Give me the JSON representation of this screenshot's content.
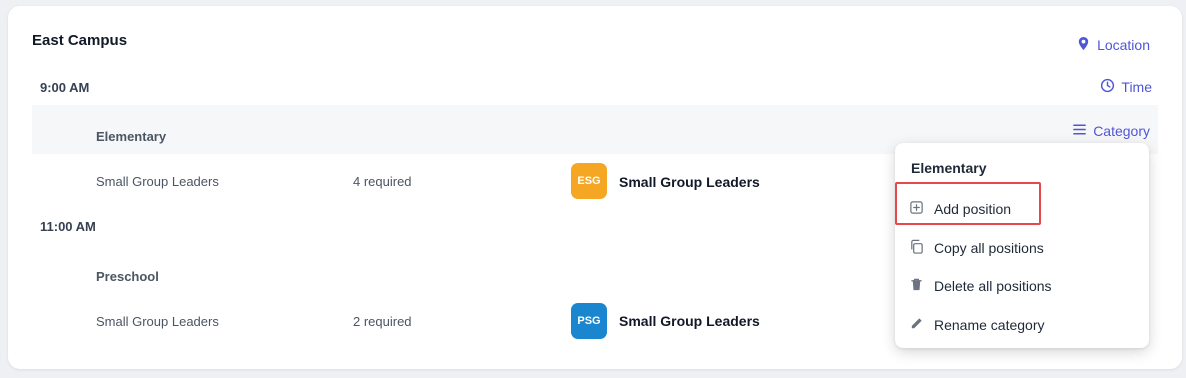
{
  "campus": {
    "title": "East Campus"
  },
  "actions": {
    "location_label": "Location",
    "time_label": "Time",
    "category_label": "Category"
  },
  "schedule": [
    {
      "time": "9:00 AM",
      "category": "Elementary",
      "position": "Small Group Leaders",
      "required": "4 required",
      "team": {
        "badge": "ESG",
        "name": "Small Group Leaders",
        "color": "#f5a623"
      }
    },
    {
      "time": "11:00 AM",
      "category": "Preschool",
      "position": "Small Group Leaders",
      "required": "2 required",
      "team": {
        "badge": "PSG",
        "name": "Small Group Leaders",
        "color": "#1a86d0"
      }
    }
  ],
  "menu": {
    "title": "Elementary",
    "items": [
      {
        "label": "Add position",
        "icon": "plus-square-icon"
      },
      {
        "label": "Copy all positions",
        "icon": "copy-icon"
      },
      {
        "label": "Delete all positions",
        "icon": "trash-icon"
      },
      {
        "label": "Rename category",
        "icon": "pencil-icon"
      }
    ]
  },
  "colors": {
    "accent": "#4f56d6",
    "highlight": "#e5484d"
  }
}
